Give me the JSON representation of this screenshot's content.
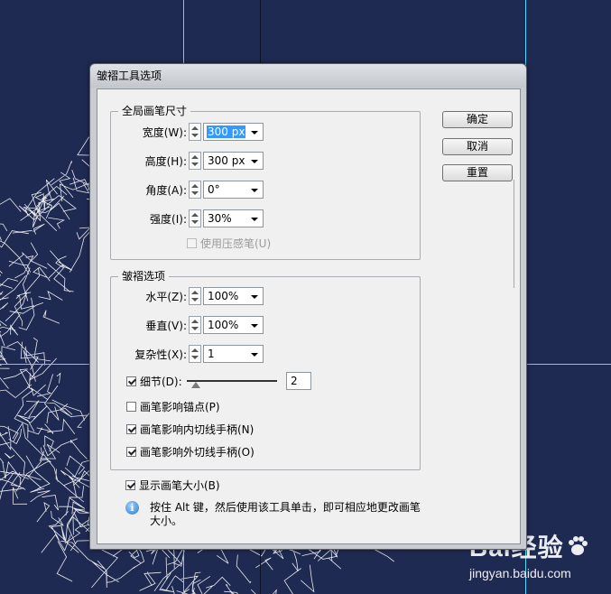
{
  "dialog": {
    "title": "皱褶工具选项",
    "buttons": {
      "ok": "确定",
      "cancel": "取消",
      "reset": "重置"
    }
  },
  "global_brush": {
    "title": "全局画笔尺寸",
    "fields": [
      {
        "label": "宽度(W):",
        "value": "300 px"
      },
      {
        "label": "高度(H):",
        "value": "300 px"
      },
      {
        "label": "角度(A):",
        "value": "0°"
      },
      {
        "label": "强度(I):",
        "value": "30%"
      }
    ],
    "pressure_label": "使用压感笔(U)"
  },
  "crinkle": {
    "title": "皱褶选项",
    "fields": [
      {
        "label": "水平(Z):",
        "value": "100%"
      },
      {
        "label": "垂直(V):",
        "value": "100%"
      },
      {
        "label": "复杂性(X):",
        "value": "1"
      }
    ],
    "detail_label": "细节(D):",
    "detail_value": "2",
    "detail_fraction": 0.1,
    "anchor_label": "画笔影响锚点(P)",
    "in_tangent_label": "画笔影响内切线手柄(N)",
    "out_tangent_label": "画笔影响外切线手柄(O)"
  },
  "show_brush_size_label": "显示画笔大小(B)",
  "info_text": "按住 Alt 键，然后使用该工具单击，即可相应地更改画笔大小。",
  "watermark": {
    "brand": "Bai经验",
    "url": "jingyan.baidu.com"
  }
}
